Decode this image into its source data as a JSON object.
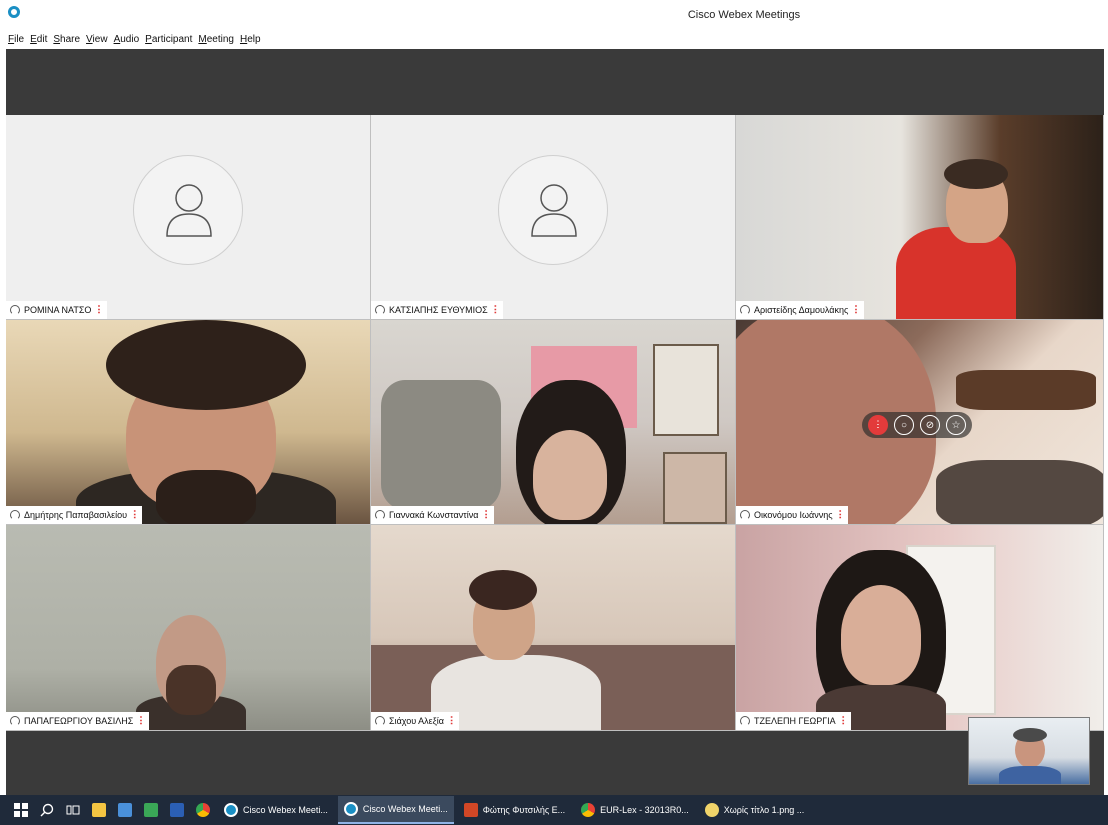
{
  "window": {
    "title": "Cisco Webex Meetings"
  },
  "menu": [
    "File",
    "Edit",
    "Share",
    "View",
    "Audio",
    "Participant",
    "Meeting",
    "Help"
  ],
  "participants": [
    {
      "name": "ΡΟΜΙΝΑ ΝΑΤΣΟ",
      "video": false
    },
    {
      "name": "ΚΑΤΣΙΑΠΗΣ ΕΥΘΥΜΙΟΣ",
      "video": false
    },
    {
      "name": "Αριστείδης Δαμουλάκης",
      "video": true
    },
    {
      "name": "Δημήτρης Παπαβασιλείου",
      "video": true
    },
    {
      "name": "Γιαννακά Κωνσταντίνα",
      "video": true
    },
    {
      "name": "Οικονόμου Ιωάννης",
      "video": true
    },
    {
      "name": "ΠΑΠΑΓΕΩΡΓΙΟΥ ΒΑΣΙΛΗΣ",
      "video": true
    },
    {
      "name": "Σιάχου Αλεξία",
      "video": true
    },
    {
      "name": "ΤΖΕΛΕΠΗ ΓΕΩΡΓΙΑ",
      "video": true
    }
  ],
  "taskbar": {
    "items": [
      {
        "label": "Cisco Webex Meeti...",
        "icon": "webex-icon",
        "active": false
      },
      {
        "label": "Cisco Webex Meeti...",
        "icon": "webex-icon",
        "active": true
      },
      {
        "label": "Φώτης Φυτσιλής Ε...",
        "icon": "powerpoint-icon",
        "active": false
      },
      {
        "label": "EUR-Lex - 32013R0...",
        "icon": "chrome-icon",
        "active": false
      },
      {
        "label": "Χωρίς τίτλο 1.png ...",
        "icon": "paint-icon",
        "active": false
      }
    ]
  },
  "colors": {
    "accent": "#1a8fc4",
    "mute_red": "#e03a3a",
    "strip": "#3a3a3a",
    "taskbar": "#1f2a3a"
  }
}
